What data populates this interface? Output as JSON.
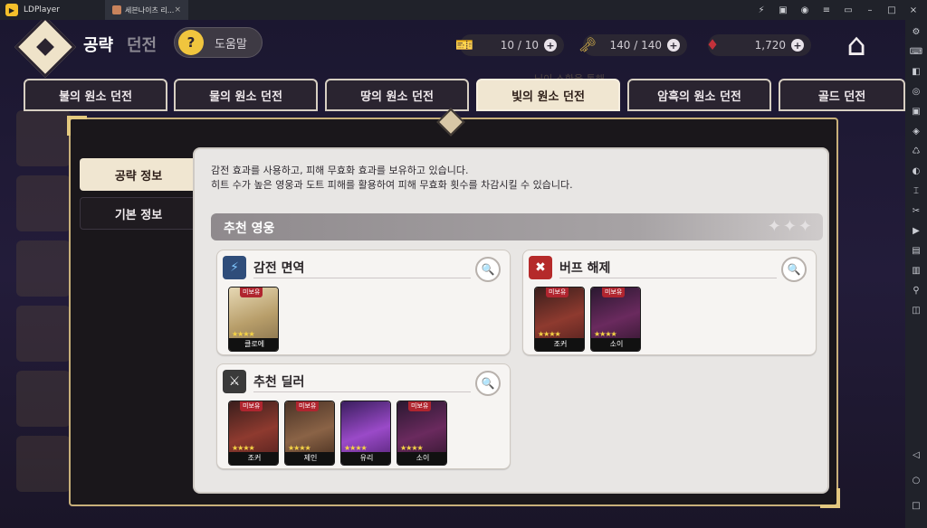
{
  "titlebar": {
    "app_name": "LDPlayer",
    "tab_title": "세븐나이츠 리...",
    "tab_close": "×",
    "controls": [
      "⚡",
      "▣",
      "◉",
      "≡",
      "▭",
      "–",
      "□",
      "×"
    ]
  },
  "emulator_sidebar": {
    "icons": [
      "gear-icon",
      "gamepad-icon",
      "keyboard-icon",
      "record-icon",
      "screenshot-icon",
      "location-icon",
      "shake-icon",
      "rotate-icon",
      "volume-icon",
      "cut-icon",
      "video-icon",
      "folder-icon",
      "apk-icon",
      "gps-icon",
      "multi-icon"
    ],
    "glyphs": [
      "⚙",
      "⌨",
      "◧",
      "◎",
      "▣",
      "◈",
      "♺",
      "◐",
      "⌶",
      "✂",
      "▶",
      "▤",
      "▥",
      "⚲",
      "◫"
    ],
    "nav": [
      "◁",
      "○",
      "□"
    ]
  },
  "header": {
    "title": "공략",
    "subtitle": "던전",
    "help_label": "도움말",
    "resources": [
      {
        "icon": "ticket-icon",
        "glyph": "🎫",
        "value": "10 / 10"
      },
      {
        "icon": "key-icon",
        "glyph": "🗝",
        "value": "140 / 140"
      },
      {
        "icon": "ruby-icon",
        "glyph": "♦",
        "value": "1,720"
      }
    ],
    "plus": "+",
    "home_glyph": "⌂"
  },
  "marquee": "님이 소환을 통해",
  "tabs": [
    {
      "label": "불의 원소 던전",
      "active": false
    },
    {
      "label": "물의 원소 던전",
      "active": false
    },
    {
      "label": "땅의 원소 던전",
      "active": false
    },
    {
      "label": "빛의 원소 던전",
      "active": true
    },
    {
      "label": "암흑의 원소 던전",
      "active": false
    },
    {
      "label": "골드 던전",
      "active": false
    }
  ],
  "side_tabs": {
    "strategy": "공략 정보",
    "basic": "기본 정보"
  },
  "description": {
    "line1": "감전 효과를 사용하고, 피해 무효화 효과를 보유하고 있습니다.",
    "line2": "히트 수가 높은 영웅과 도트 피해를 활용하여 피해 무효화 횟수를 차감시킬 수 있습니다."
  },
  "recommended": {
    "title": "추천 영웅",
    "stars": "✦✦✦"
  },
  "groups": [
    {
      "name": "shock-immunity",
      "title": "감전 면역",
      "icon": "shock-shield-icon",
      "icon_glyph": "⚡",
      "icon_bg": "#2f4d7a",
      "heroes": [
        {
          "badge": "미보유",
          "stars": "★★★★",
          "name": "클로에",
          "color": "#c8b98a"
        }
      ]
    },
    {
      "name": "buff-removal",
      "title": "버프 해제",
      "icon": "buff-removal-icon",
      "icon_glyph": "✖",
      "icon_bg": "#b52a2a",
      "heroes": [
        {
          "badge": "미보유",
          "stars": "★★★★",
          "name": "조커",
          "color": "#7a2c2a"
        },
        {
          "badge": "미보유",
          "stars": "★★★★",
          "name": "소이",
          "color": "#5a2a5a"
        }
      ]
    },
    {
      "name": "recommended-dealer",
      "title": "추천 딜러",
      "icon": "crossed-swords-icon",
      "icon_glyph": "⚔",
      "icon_bg": "#3a3a3a",
      "heroes": [
        {
          "badge": "미보유",
          "stars": "★★★★",
          "name": "조커",
          "color": "#7a2c2a"
        },
        {
          "badge": "미보유",
          "stars": "★★★★",
          "name": "제인",
          "color": "#6b4a3a"
        },
        {
          "badge": "",
          "stars": "★★★★",
          "name": "유리",
          "color": "#7a3aa0"
        },
        {
          "badge": "미보유",
          "stars": "★★★★",
          "name": "소이",
          "color": "#5a2a5a"
        }
      ]
    }
  ],
  "search_glyph": "🔍"
}
